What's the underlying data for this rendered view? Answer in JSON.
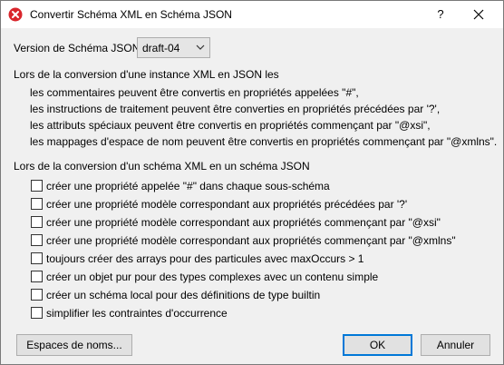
{
  "window": {
    "title": "Convertir Schéma XML en Schéma JSON",
    "help_label": "?"
  },
  "version": {
    "label": "Version de Schéma JSON:",
    "selected": "draft-04"
  },
  "instance_section": {
    "intro": "Lors de la conversion d'une instance XML en JSON les",
    "lines": [
      "les commentaires peuvent être convertis en propriétés appelées \"#\",",
      "les instructions de traitement peuvent être converties en propriétés précédées par '?',",
      "les attributs spéciaux peuvent être convertis en propriétés commençant par \"@xsi\",",
      "les mappages d'espace de nom peuvent être convertis en propriétés commençant par \"@xmlns\"."
    ]
  },
  "schema_section": {
    "heading": "Lors de la conversion d'un schéma XML en un schéma JSON",
    "options": [
      {
        "label": "créer une propriété appelée \"#\" dans chaque sous-schéma",
        "checked": false
      },
      {
        "label": "créer une propriété modèle correspondant aux propriétés précédées par '?'",
        "checked": false
      },
      {
        "label": "créer une propriété modèle correspondant aux propriétés commençant par \"@xsi\"",
        "checked": false
      },
      {
        "label": "créer une propriété modèle correspondant aux propriétés commençant par \"@xmlns\"",
        "checked": false
      },
      {
        "label": "toujours créer des arrays pour des particules avec maxOccurs > 1",
        "checked": false
      },
      {
        "label": "créer un objet pur pour des types complexes avec un contenu simple",
        "checked": false
      },
      {
        "label": "créer un schéma local pour des définitions de type builtin",
        "checked": false
      },
      {
        "label": "simplifier les contraintes d'occurrence",
        "checked": false
      }
    ]
  },
  "buttons": {
    "namespaces": "Espaces de noms...",
    "ok": "OK",
    "cancel": "Annuler"
  },
  "colors": {
    "dialog_bg": "#f0f0f0",
    "titlebar_bg": "#ffffff",
    "app_icon_red": "#d9262c",
    "focus_blue": "#0078d7"
  },
  "icons": {
    "app": "close-x-circle-icon",
    "help": "question-mark",
    "close": "close-icon",
    "dropdown": "chevron-down-icon"
  }
}
